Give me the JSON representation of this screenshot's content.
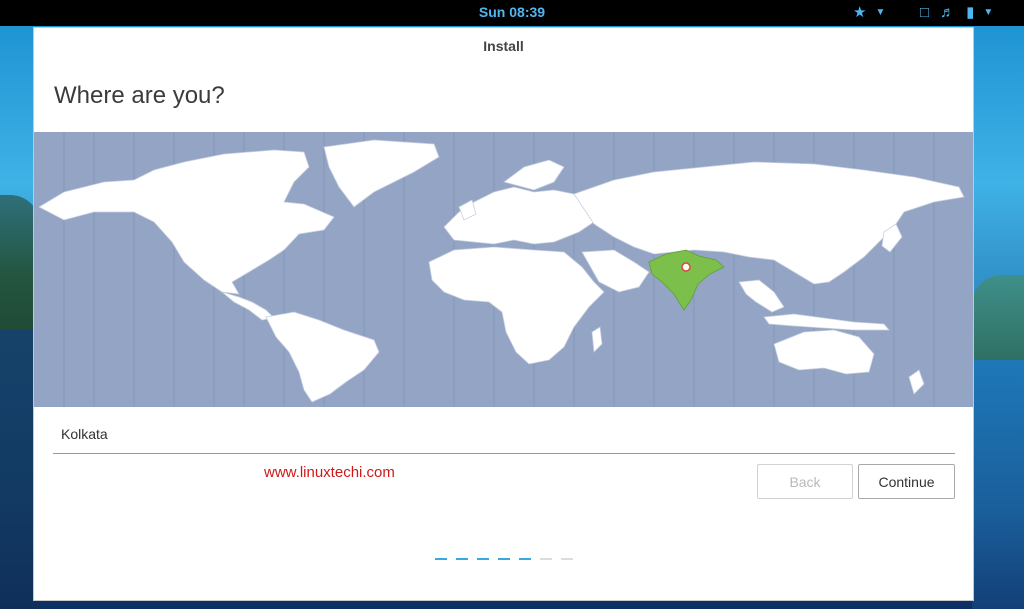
{
  "topbar": {
    "clock": "Sun 08:39",
    "icons": [
      "accessibility-icon",
      "dropdown-icon",
      "display-icon",
      "volume-icon",
      "battery-icon"
    ]
  },
  "window": {
    "title": "Install",
    "heading": "Where are you?"
  },
  "map": {
    "highlighted_region": "India",
    "highlight_color": "#7cc04b",
    "ocean_color": "#93a4c4",
    "land_color": "#ffffff"
  },
  "timezone_field": {
    "value": "Kolkata"
  },
  "watermark": "www.linuxtechi.com",
  "buttons": {
    "back": "Back",
    "continue": "Continue"
  },
  "progress": {
    "total_steps": 7,
    "completed_steps": 5,
    "active_color": "#3aa8e0",
    "inactive_color": "#dcdcdc"
  }
}
